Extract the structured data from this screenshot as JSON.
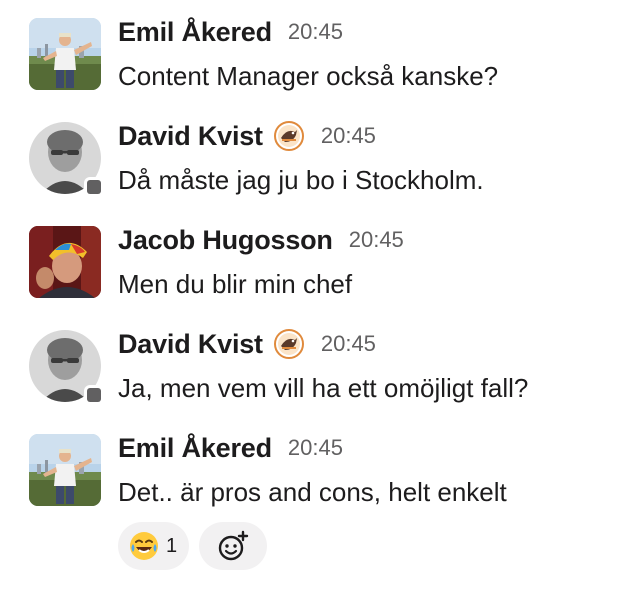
{
  "messages": [
    {
      "author": "Emil Åkered",
      "time": "20:45",
      "text": "Content Manager också kanske?",
      "avatar": "emil-avatar",
      "badge": null
    },
    {
      "author": "David Kvist",
      "time": "20:45",
      "text": "Då måste jag ju bo i Stockholm.",
      "avatar": "david-avatar",
      "badge": "bird-badge"
    },
    {
      "author": "Jacob Hugosson",
      "time": "20:45",
      "text": "Men du blir min chef",
      "avatar": "jacob-avatar",
      "badge": null
    },
    {
      "author": "David Kvist",
      "time": "20:45",
      "text": "Ja, men vem vill ha ett omöjligt fall?",
      "avatar": "david-avatar",
      "badge": "bird-badge"
    },
    {
      "author": "Emil Åkered",
      "time": "20:45",
      "text": "Det.. är pros and cons, helt enkelt",
      "avatar": "emil-avatar",
      "badge": null
    }
  ],
  "reactions": [
    {
      "emoji": "😂",
      "icon": "laughing-emoji-icon",
      "count": "1"
    }
  ],
  "add_reaction_icon": "add-reaction-icon",
  "colors": {
    "text": "#1d1c1d",
    "muted": "#616061",
    "reaction_bg": "#f2f1f2",
    "presence_away": "#616061"
  }
}
